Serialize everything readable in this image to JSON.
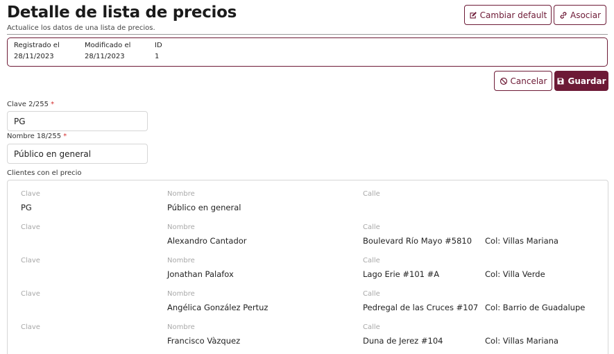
{
  "header": {
    "title": "Detalle de lista de precios",
    "subtitle": "Actualice los datos de una lista de precios."
  },
  "toolbar": {
    "change_default_label": "Cambiar default",
    "associate_label": "Asociar",
    "cancel_label": "Cancelar",
    "save_label": "Guardar"
  },
  "meta": {
    "registered_label": "Registrado el",
    "registered_value": "28/11/2023",
    "modified_label": "Modificado el",
    "modified_value": "28/11/2023",
    "id_label": "ID",
    "id_value": "1"
  },
  "form": {
    "clave_label": "Clave 2/255",
    "clave_value": "PG",
    "nombre_label": "Nombre 18/255",
    "nombre_value": "Público en general",
    "required_mark": "*"
  },
  "clients": {
    "label": "Clientes con el precio",
    "col_clave": "Clave",
    "col_nombre": "Nombre",
    "col_calle": "Calle",
    "rows": [
      {
        "clave": "PG",
        "nombre": "Público en general",
        "calle": "",
        "colonia": ""
      },
      {
        "clave": "",
        "nombre": "Alexandro Cantador",
        "calle": "Boulevard Río Mayo #5810",
        "colonia": "Col: Villas Mariana"
      },
      {
        "clave": "",
        "nombre": "Jonathan Palafox",
        "calle": "Lago Erie #101 #A",
        "colonia": "Col: Villa Verde"
      },
      {
        "clave": "",
        "nombre": "Angélica González Pertuz",
        "calle": "Pedregal de las Cruces #107",
        "colonia": "Col: Barrio de Guadalupe"
      },
      {
        "clave": "",
        "nombre": "Francisco Vàzquez",
        "calle": "Duna de Jerez #104",
        "colonia": "Col: Villas Mariana"
      }
    ]
  },
  "colors": {
    "accent": "#6d1a36",
    "required": "#d32f2f"
  }
}
